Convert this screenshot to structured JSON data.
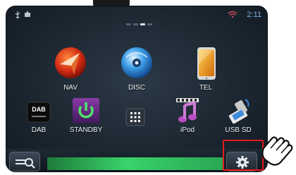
{
  "status": {
    "time": "2:11"
  },
  "apps": {
    "nav": "NAV",
    "disc": "DISC",
    "tel": "TEL",
    "dab": "DAB",
    "standby": "STANDBY",
    "ipod": "iPod",
    "usb_sd": "USB SD"
  },
  "icons": {
    "dab_text": "DAB"
  },
  "colors": {
    "accent_blue": "#7fb4e6",
    "highlight_red": "#e5191c",
    "strip_green": "#3ad36a"
  }
}
